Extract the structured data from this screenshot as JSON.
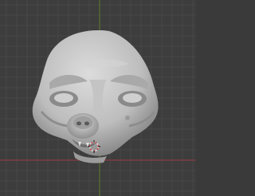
{
  "viewport": {
    "mode": "3d-sculpt-viewport",
    "object": "creature-head-sculpt",
    "colors": {
      "background": "#3d3d3d",
      "grid_line": "#474747",
      "axis_x": "#9b3b45",
      "axis_y": "#5f7d2f",
      "clay": "#c9c9c9",
      "clay_shadow": "#8e8e8e",
      "cursor": "#e6e6e6",
      "cursor_accent": "#d24848"
    },
    "icons": {
      "cursor": "3d-cursor-icon"
    }
  }
}
